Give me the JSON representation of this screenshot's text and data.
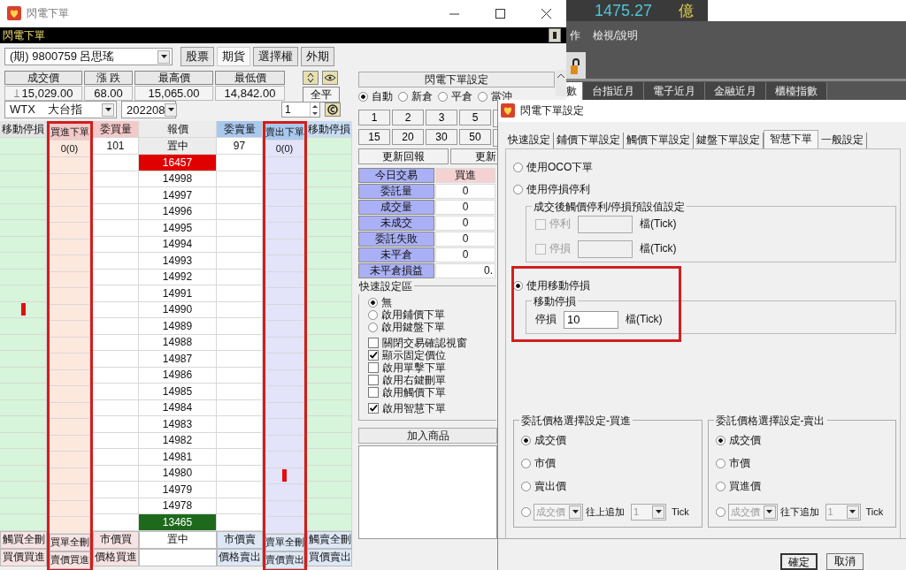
{
  "main_window": {
    "title": "閃電下單",
    "header": "閃電下單",
    "account": "(期)  9800759 呂思瑤",
    "market_tabs": [
      {
        "label": "股票",
        "selected": false
      },
      {
        "label": "期貨",
        "selected": true
      },
      {
        "label": "選擇權",
        "selected": false
      },
      {
        "label": "外期",
        "selected": false
      }
    ],
    "quote": [
      {
        "label": "成交價",
        "value": "15,029.00",
        "falling": true
      },
      {
        "label": "漲  跌",
        "value": "68.00"
      },
      {
        "label": "最高價",
        "value": "15,065.00"
      },
      {
        "label": "最低價",
        "value": "14,842.00"
      }
    ],
    "close_all": "全平",
    "symbol": "WTX    大台指",
    "month": "202208",
    "quantity": "1"
  },
  "ladder": {
    "columns": [
      {
        "label": "移動停損",
        "kind": "stop_buy",
        "outlined": false,
        "buttons": [
          "觸買全刪",
          "買價買進"
        ]
      },
      {
        "label": "買進下單",
        "kind": "buy_order",
        "outlined": true,
        "summary": "0(0)",
        "buttons": [
          "買單全刪",
          "賣價買進"
        ]
      },
      {
        "label": "委買量",
        "kind": "bid",
        "outlined": false,
        "summary": "101",
        "buttons": [
          "市價買",
          "價格買進"
        ]
      },
      {
        "label": "報價",
        "kind": "price",
        "outlined": false,
        "summary": "置中",
        "buttons": [
          "置中"
        ]
      },
      {
        "label": "委賣量",
        "kind": "ask",
        "outlined": false,
        "summary": "97",
        "buttons": [
          "市價賣",
          "價格賣出"
        ]
      },
      {
        "label": "賣出下單",
        "kind": "sell_order",
        "outlined": true,
        "summary": "0(0)",
        "buttons": [
          "賣單全刪",
          "賣價賣出"
        ]
      },
      {
        "label": "移動停損",
        "kind": "stop_sell",
        "outlined": false,
        "buttons": [
          "觸賣全刪",
          "買價賣出"
        ]
      }
    ],
    "prices": [
      {
        "price": "16457",
        "kind": "high",
        "stop_marker": false,
        "order_marker": false
      },
      {
        "price": "14998",
        "kind": "normal",
        "stop_marker": false,
        "order_marker": false
      },
      {
        "price": "14997",
        "kind": "normal",
        "stop_marker": false,
        "order_marker": false
      },
      {
        "price": "14996",
        "kind": "normal",
        "stop_marker": false,
        "order_marker": false
      },
      {
        "price": "14995",
        "kind": "normal",
        "stop_marker": false,
        "order_marker": false
      },
      {
        "price": "14994",
        "kind": "normal",
        "stop_marker": false,
        "order_marker": false
      },
      {
        "price": "14993",
        "kind": "normal",
        "stop_marker": false,
        "order_marker": false
      },
      {
        "price": "14992",
        "kind": "normal",
        "stop_marker": false,
        "order_marker": false
      },
      {
        "price": "14991",
        "kind": "normal",
        "stop_marker": false,
        "order_marker": false
      },
      {
        "price": "14990",
        "kind": "normal",
        "stop_marker": true,
        "order_marker": false
      },
      {
        "price": "14989",
        "kind": "normal",
        "stop_marker": false,
        "order_marker": false
      },
      {
        "price": "14988",
        "kind": "normal",
        "stop_marker": false,
        "order_marker": false
      },
      {
        "price": "14987",
        "kind": "normal",
        "stop_marker": false,
        "order_marker": false
      },
      {
        "price": "14986",
        "kind": "normal",
        "stop_marker": false,
        "order_marker": false
      },
      {
        "price": "14985",
        "kind": "normal",
        "stop_marker": false,
        "order_marker": false
      },
      {
        "price": "14984",
        "kind": "normal",
        "stop_marker": false,
        "order_marker": false
      },
      {
        "price": "14983",
        "kind": "normal",
        "stop_marker": false,
        "order_marker": false
      },
      {
        "price": "14982",
        "kind": "normal",
        "stop_marker": false,
        "order_marker": false
      },
      {
        "price": "14981",
        "kind": "normal",
        "stop_marker": false,
        "order_marker": false
      },
      {
        "price": "14980",
        "kind": "normal",
        "stop_marker": false,
        "order_marker": true
      },
      {
        "price": "14979",
        "kind": "normal",
        "stop_marker": false,
        "order_marker": false
      },
      {
        "price": "14978",
        "kind": "normal",
        "stop_marker": false,
        "order_marker": false
      },
      {
        "price": "13465",
        "kind": "low",
        "stop_marker": false,
        "order_marker": false
      }
    ]
  },
  "order_panel": {
    "title": "閃電下單設定",
    "modes": [
      {
        "label": "自動",
        "selected": true
      },
      {
        "label": "新倉",
        "selected": false
      },
      {
        "label": "平倉",
        "selected": false
      },
      {
        "label": "當沖",
        "selected": false
      }
    ],
    "quantities": [
      "1",
      "2",
      "3",
      "5",
      "15",
      "20",
      "30",
      "50"
    ],
    "refresh_buttons": [
      "更新回報",
      "更新"
    ],
    "trade_table": {
      "header": [
        "今日交易",
        "買進"
      ],
      "rows": [
        {
          "label": "委託量",
          "value": "0"
        },
        {
          "label": "成交量",
          "value": "0"
        },
        {
          "label": "未成交",
          "value": "0"
        },
        {
          "label": "委託失敗",
          "value": "0"
        },
        {
          "label": "未平倉",
          "value": "0"
        },
        {
          "label": "未平倉損益",
          "value": "0.",
          "kind": "total"
        }
      ]
    },
    "quick_settings": {
      "title": "快速設定區",
      "radios": [
        {
          "label": "無",
          "selected": true
        },
        {
          "label": "啟用鋪價下單",
          "selected": false
        },
        {
          "label": "啟用鍵盤下單",
          "selected": false
        }
      ],
      "checks": [
        {
          "label": "關閉交易確認視窗",
          "checked": false
        },
        {
          "label": "顯示固定價位",
          "checked": true
        },
        {
          "label": "啟用單擊下單",
          "checked": false
        },
        {
          "label": "啟用右鍵刪單",
          "checked": false
        },
        {
          "label": "啟用觸價下單",
          "checked": false
        },
        {
          "label": "啟用智慧下單",
          "checked": true
        }
      ]
    },
    "watchlist": {
      "title": "加入商品"
    }
  },
  "background_app": {
    "stat_value": "1475.27",
    "stat_unit": "億",
    "menu": [
      "作",
      "檢視/說明"
    ],
    "tabs": [
      {
        "label": "數",
        "selected": true
      },
      {
        "label": "台指近月",
        "selected": false
      },
      {
        "label": "電子近月",
        "selected": false
      },
      {
        "label": "金融近月",
        "selected": false
      },
      {
        "label": "櫃檯指數",
        "selected": false
      }
    ]
  },
  "settings_dialog": {
    "title": "閃電下單設定",
    "tabs": [
      {
        "label": "快速設定",
        "selected": false
      },
      {
        "label": "鋪價下單設定",
        "selected": false
      },
      {
        "label": "觸價下單設定",
        "selected": false
      },
      {
        "label": "鍵盤下單設定",
        "selected": false
      },
      {
        "label": "智慧下單",
        "selected": true
      },
      {
        "label": "一般設定",
        "selected": false
      }
    ],
    "oco": {
      "label": "使用OCO下單",
      "selected": false
    },
    "stop_profit": {
      "label": "使用停損停利",
      "selected": false,
      "group_title": "成交後觸價停利/停損預設值設定",
      "fields": [
        {
          "label": "停利",
          "checked": false,
          "disabled": true,
          "unit": "檔(Tick)"
        },
        {
          "label": "停損",
          "checked": false,
          "disabled": true,
          "unit": "檔(Tick)"
        }
      ]
    },
    "trailing_stop": {
      "label": "使用移動停損",
      "selected": true,
      "outlined": true,
      "group_title": "移動停損",
      "field_label": "停損",
      "value": "10",
      "unit": "檔(Tick)"
    },
    "price_groups": [
      {
        "title": "委託價格選擇設定-買進",
        "options": [
          {
            "label": "成交價",
            "selected": true
          },
          {
            "label": "市價",
            "selected": false
          },
          {
            "label": "賣出價",
            "selected": false
          }
        ],
        "chase": {
          "selected": false,
          "base": "成交價",
          "direction": "往上追加",
          "ticks": "1",
          "unit": "Tick"
        }
      },
      {
        "title": "委託價格選擇設定-賣出",
        "options": [
          {
            "label": "成交價",
            "selected": true
          },
          {
            "label": "市價",
            "selected": false
          },
          {
            "label": "買進價",
            "selected": false
          }
        ],
        "chase": {
          "selected": false,
          "base": "成交價",
          "direction": "往下追加",
          "ticks": "1",
          "unit": "Tick"
        }
      }
    ],
    "buttons": [
      "確定",
      "取消"
    ]
  }
}
